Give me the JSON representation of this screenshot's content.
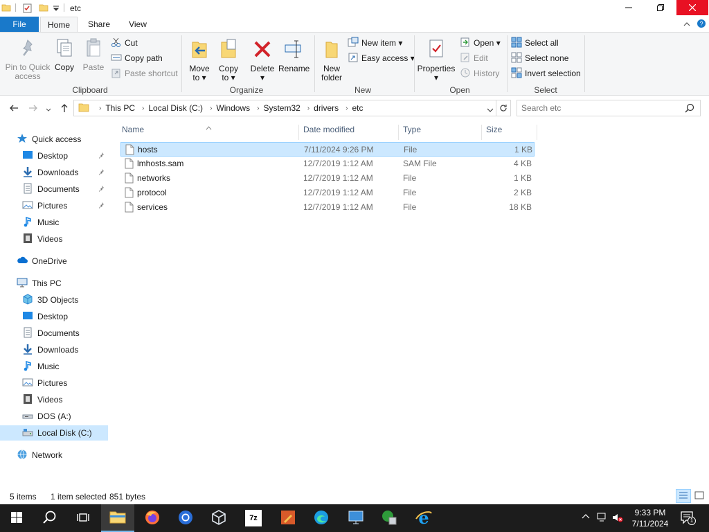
{
  "window": {
    "title": "etc"
  },
  "ribbon_tabs": {
    "file": "File",
    "home": "Home",
    "share": "Share",
    "view": "View"
  },
  "ribbon": {
    "clipboard": {
      "pin_line1": "Pin to Quick",
      "pin_line2": "access",
      "copy": "Copy",
      "paste": "Paste",
      "cut": "Cut",
      "copy_path": "Copy path",
      "paste_shortcut": "Paste shortcut",
      "label": "Clipboard"
    },
    "organize": {
      "move_line1": "Move",
      "move_line2": "to",
      "copy_line1": "Copy",
      "copy_line2": "to",
      "delete": "Delete",
      "rename": "Rename",
      "label": "Organize"
    },
    "new": {
      "folder_line1": "New",
      "folder_line2": "folder",
      "new_item": "New item",
      "easy_access": "Easy access",
      "label": "New"
    },
    "open": {
      "properties": "Properties",
      "open": "Open",
      "edit": "Edit",
      "history": "History",
      "label": "Open"
    },
    "select": {
      "select_all": "Select all",
      "select_none": "Select none",
      "invert": "Invert selection",
      "label": "Select"
    }
  },
  "address": {
    "crumbs": [
      "This PC",
      "Local Disk (C:)",
      "Windows",
      "System32",
      "drivers",
      "etc"
    ],
    "search_placeholder": "Search etc"
  },
  "nav_pane": {
    "quick_access": "Quick access",
    "qa_items": [
      "Desktop",
      "Downloads",
      "Documents",
      "Pictures",
      "Music",
      "Videos"
    ],
    "onedrive": "OneDrive",
    "this_pc": "This PC",
    "pc_items": [
      "3D Objects",
      "Desktop",
      "Documents",
      "Downloads",
      "Music",
      "Pictures",
      "Videos",
      "DOS (A:)",
      "Local Disk (C:)"
    ],
    "network": "Network"
  },
  "file_list": {
    "columns": {
      "name": "Name",
      "date": "Date modified",
      "type": "Type",
      "size": "Size"
    },
    "rows": [
      {
        "name": "hosts",
        "date": "7/11/2024 9:26 PM",
        "type": "File",
        "size": "1 KB"
      },
      {
        "name": "lmhosts.sam",
        "date": "12/7/2019 1:12 AM",
        "type": "SAM File",
        "size": "4 KB"
      },
      {
        "name": "networks",
        "date": "12/7/2019 1:12 AM",
        "type": "File",
        "size": "1 KB"
      },
      {
        "name": "protocol",
        "date": "12/7/2019 1:12 AM",
        "type": "File",
        "size": "2 KB"
      },
      {
        "name": "services",
        "date": "12/7/2019 1:12 AM",
        "type": "File",
        "size": "18 KB"
      }
    ]
  },
  "status": {
    "items": "5 items",
    "selected": "1 item selected",
    "bytes": "851 bytes"
  },
  "taskbar": {
    "time": "9:33 PM",
    "date": "7/11/2024",
    "notification_count": "1",
    "zip_label": "7z"
  },
  "colors": {
    "accent": "#1979ca",
    "selection": "#cce8ff",
    "close": "#e81123",
    "folder": "#f8d775"
  }
}
